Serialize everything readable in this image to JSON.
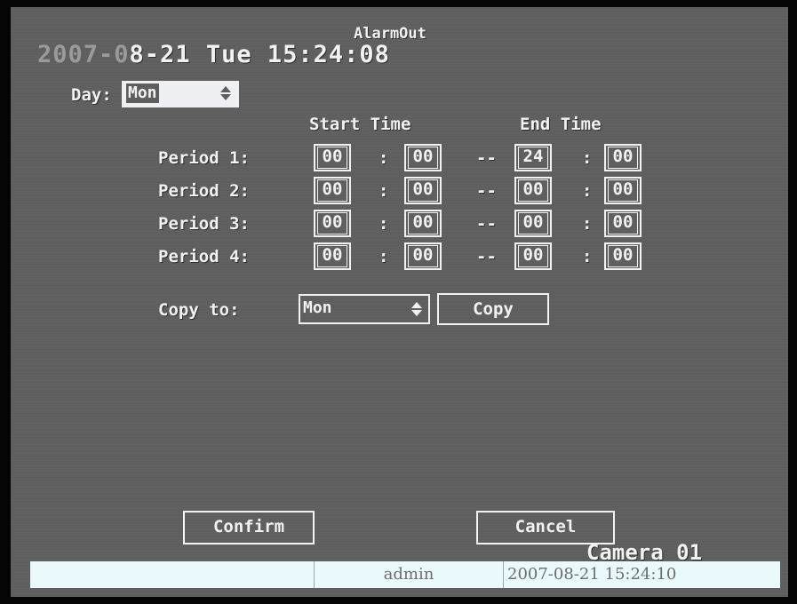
{
  "header": {
    "title": "AlarmOut",
    "clock_dim": "2007-0",
    "clock_bright": "8-21 Tue 15:24:08"
  },
  "day": {
    "label": "Day:",
    "value": "Mon"
  },
  "columns": {
    "start": "Start Time",
    "end": "End Time"
  },
  "separators": {
    "colon": ":",
    "dash": "--"
  },
  "periods": [
    {
      "label": "Period 1:",
      "start_h": "00",
      "start_m": "00",
      "end_h": "24",
      "end_m": "00"
    },
    {
      "label": "Period 2:",
      "start_h": "00",
      "start_m": "00",
      "end_h": "00",
      "end_m": "00"
    },
    {
      "label": "Period 3:",
      "start_h": "00",
      "start_m": "00",
      "end_h": "00",
      "end_m": "00"
    },
    {
      "label": "Period 4:",
      "start_h": "00",
      "start_m": "00",
      "end_h": "00",
      "end_m": "00"
    }
  ],
  "copy": {
    "label": "Copy to:",
    "value": "Mon",
    "button": "Copy"
  },
  "buttons": {
    "confirm": "Confirm",
    "cancel": "Cancel"
  },
  "camera": "Camera 01",
  "statusbar": {
    "user": "admin",
    "datetime": "2007-08-21 15:24:10"
  },
  "colors": {
    "text": "#f2f2f2",
    "background": "#5e5e5e",
    "statusbar": "#eaf9fb",
    "day_highlight": "#eef0f4"
  }
}
